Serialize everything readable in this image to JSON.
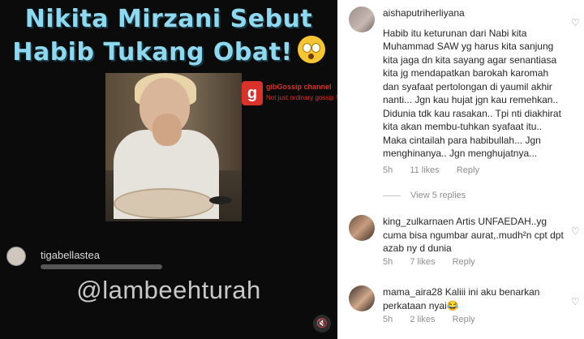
{
  "video": {
    "headline_line1": "Nikita Mirzani Sebut",
    "headline_line2": "Habib Tukang Obat!",
    "headline_emoji": "flushed-face-emoji",
    "channel_logo_letter": "g",
    "channel_name": "gibGossip channel",
    "channel_tagline": "Not just ordinary gossip !",
    "overlay_username": "tigabellastea",
    "watermark": "@lambeehturah",
    "mute_icon": "muted-speaker-icon"
  },
  "comments": [
    {
      "username": "aishaputriherliyana",
      "text": "Habib itu keturunan dari Nabi kita Muhammad SAW yg harus kita sanjung kita jaga dn kita sayang agar senantiasa kita jg mendapatkan barokah karomah dan syafaat pertolongan di yaumil akhir nanti... Jgn kau hujat jgn kau remehkan.. Didunia tdk kau rasakan.. Tpi nti diakhirat kita akan membu-tuhkan syafaat itu.. Maka cintailah para habibullah... Jgn menghinanya.. Jgn menghujatnya...",
      "time": "5h",
      "likes": "11 likes",
      "reply": "Reply"
    },
    {
      "username": "king_zulkarnaen",
      "text": "Artis UNFAEDAH..yg cuma bisa ngumbar aurat,.mudh²n cpt dpt azab ny d dunia",
      "time": "5h",
      "likes": "7 likes",
      "reply": "Reply"
    },
    {
      "username": "mama_aira28",
      "text": "Kaliii ini aku benarkan perkataan nyai😂",
      "time": "5h",
      "likes": "2 likes",
      "reply": "Reply"
    }
  ],
  "view_replies": "View 5 replies",
  "icons": {
    "heart": "heart-outline-icon"
  },
  "colors": {
    "headline": "#8fd9f0",
    "meta": "#8e8e8e",
    "text": "#262626"
  }
}
